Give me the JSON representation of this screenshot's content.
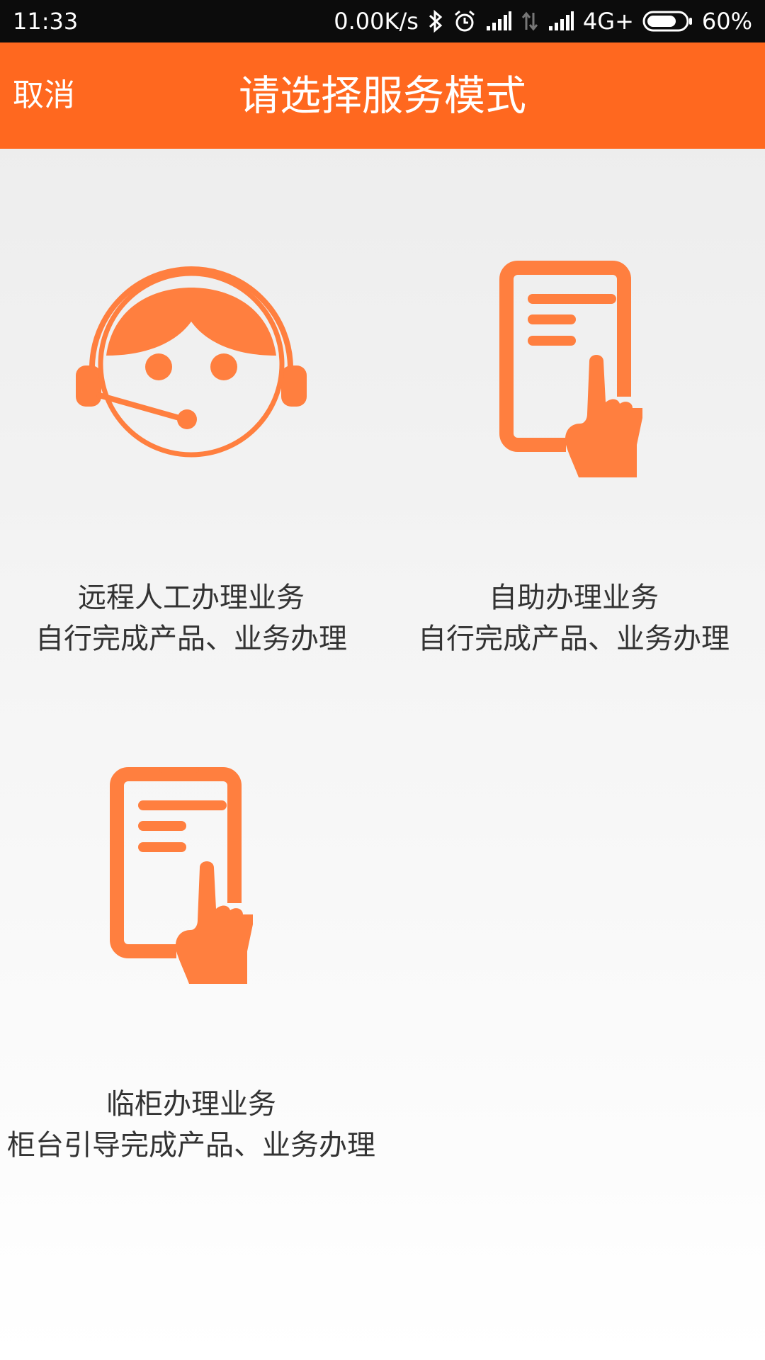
{
  "status_bar": {
    "time": "11:33",
    "network_speed": "0.00K/s",
    "network_type": "4G+",
    "battery": "60%",
    "icons": [
      "bluetooth-icon",
      "alarm-icon",
      "signal-icon",
      "data-arrows-icon",
      "signal-icon",
      "battery-icon"
    ]
  },
  "header": {
    "cancel_label": "取消",
    "title": "请选择服务模式"
  },
  "options": [
    {
      "icon": "headset-agent-icon",
      "title": "远程人工办理业务",
      "description": "自行完成产品、业务办理"
    },
    {
      "icon": "tablet-touch-icon",
      "title": "自助办理业务",
      "description": "自行完成产品、业务办理"
    },
    {
      "icon": "tablet-touch-icon",
      "title": "临柜办理业务",
      "description": "柜台引导完成产品、业务办理"
    }
  ],
  "colors": {
    "accent": "#ff681f",
    "icon": "#ff7f3f",
    "text": "#333333"
  }
}
